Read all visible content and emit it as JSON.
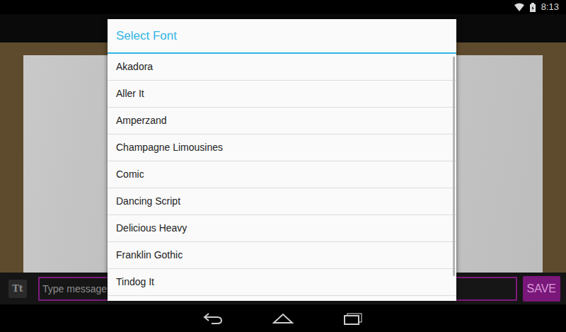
{
  "status_bar": {
    "time": "8:13"
  },
  "composer": {
    "font_button": "Tt",
    "placeholder": "Type message",
    "save": "SAVE"
  },
  "dialog": {
    "title": "Select Font",
    "items": [
      "Akadora",
      "Aller It",
      "Amperzand",
      "Champagne Limousines",
      "Comic",
      "Dancing Script",
      "Delicious Heavy",
      "Franklin Gothic",
      "Tindog It"
    ]
  }
}
